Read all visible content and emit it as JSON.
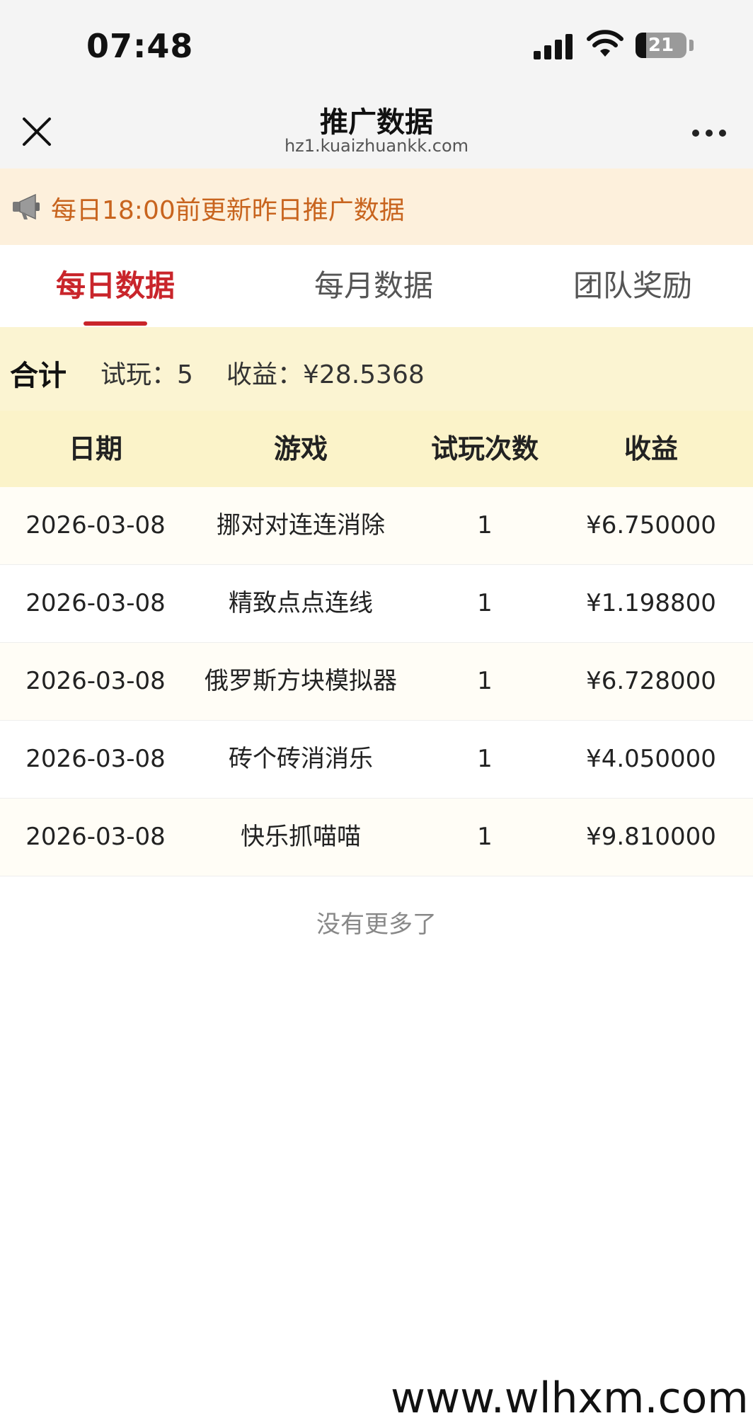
{
  "status_bar": {
    "time": "07:48",
    "battery_level": "21",
    "battery_fraction": 0.21
  },
  "nav": {
    "title": "推广数据",
    "url": "hz1.kuaizhuankk.com"
  },
  "notice": {
    "text": "每日18:00前更新昨日推广数据"
  },
  "tabs": [
    {
      "label": "每日数据",
      "active": true
    },
    {
      "label": "每月数据",
      "active": false
    },
    {
      "label": "团队奖励",
      "active": false
    }
  ],
  "summary": {
    "label": "合计",
    "trial": "试玩：5",
    "income": "收益：¥28.5368"
  },
  "table": {
    "headers": [
      "日期",
      "游戏",
      "试玩次数",
      "收益"
    ],
    "rows": [
      {
        "date": "2026-03-08",
        "game": "挪对对连连消除",
        "plays": "1",
        "income": "¥6.750000"
      },
      {
        "date": "2026-03-08",
        "game": "精致点点连线",
        "plays": "1",
        "income": "¥1.198800"
      },
      {
        "date": "2026-03-08",
        "game": "俄罗斯方块模拟器",
        "plays": "1",
        "income": "¥6.728000"
      },
      {
        "date": "2026-03-08",
        "game": "砖个砖消消乐",
        "plays": "1",
        "income": "¥4.050000"
      },
      {
        "date": "2026-03-08",
        "game": "快乐抓喵喵",
        "plays": "1",
        "income": "¥9.810000"
      }
    ]
  },
  "end_text": "没有更多了",
  "watermark": "www.wlhxm.com",
  "colors": {
    "accent": "#c9252b",
    "notice_text": "#c8641e",
    "header_bg": "#fbf3c9"
  }
}
